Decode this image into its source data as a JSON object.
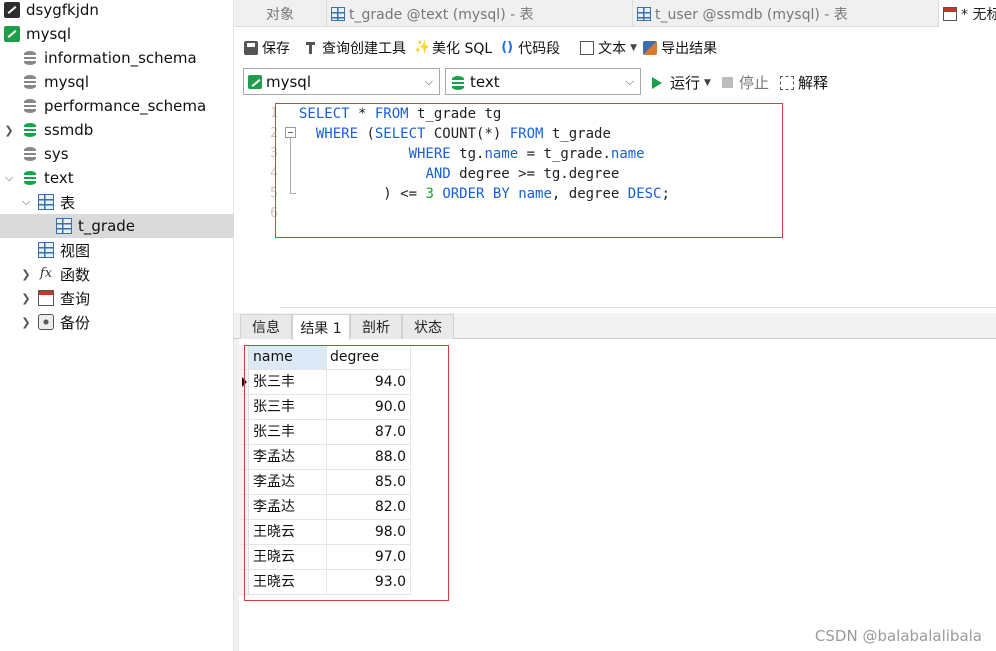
{
  "sidebar": {
    "items": [
      {
        "label": "dsygfkjdn"
      },
      {
        "label": "mysql"
      },
      {
        "label": "information_schema"
      },
      {
        "label": "mysql"
      },
      {
        "label": "performance_schema"
      },
      {
        "label": "ssmdb"
      },
      {
        "label": "sys"
      },
      {
        "label": "text"
      },
      {
        "label": "表"
      },
      {
        "label": "t_grade"
      },
      {
        "label": "视图"
      },
      {
        "label": "函数"
      },
      {
        "label": "查询"
      },
      {
        "label": "备份"
      }
    ]
  },
  "tabs": [
    {
      "label": "对象"
    },
    {
      "label": "t_grade @text (mysql) - 表"
    },
    {
      "label": "t_user @ssmdb (mysql) - 表"
    },
    {
      "label": "* 无标"
    }
  ],
  "toolbar": {
    "save": "保存",
    "query_builder": "查询创建工具",
    "beautify_sql": "美化 SQL",
    "code_snippet": "代码段",
    "text": "文本",
    "export_result": "导出结果"
  },
  "toolbar2": {
    "connection": "mysql",
    "database": "text",
    "run": "运行",
    "stop": "停止",
    "explain": "解释"
  },
  "editor": {
    "line_numbers": [
      "1",
      "2",
      "3",
      "4",
      "5",
      "6"
    ]
  },
  "result_tabs": [
    {
      "label": "信息"
    },
    {
      "label": "结果 1"
    },
    {
      "label": "剖析"
    },
    {
      "label": "状态"
    }
  ],
  "result_grid": {
    "columns": [
      "name",
      "degree"
    ],
    "rows": [
      [
        "张三丰",
        "94.0"
      ],
      [
        "张三丰",
        "90.0"
      ],
      [
        "张三丰",
        "87.0"
      ],
      [
        "李孟达",
        "88.0"
      ],
      [
        "李孟达",
        "85.0"
      ],
      [
        "李孟达",
        "82.0"
      ],
      [
        "王晓云",
        "98.0"
      ],
      [
        "王晓云",
        "97.0"
      ],
      [
        "王晓云",
        "93.0"
      ]
    ]
  },
  "watermark": "CSDN @balabalalibala",
  "colors": {
    "keyword": "#1a5fd9",
    "number": "#18a030",
    "highlight_box": "#d63d3d",
    "selected_row": "#dadada"
  }
}
